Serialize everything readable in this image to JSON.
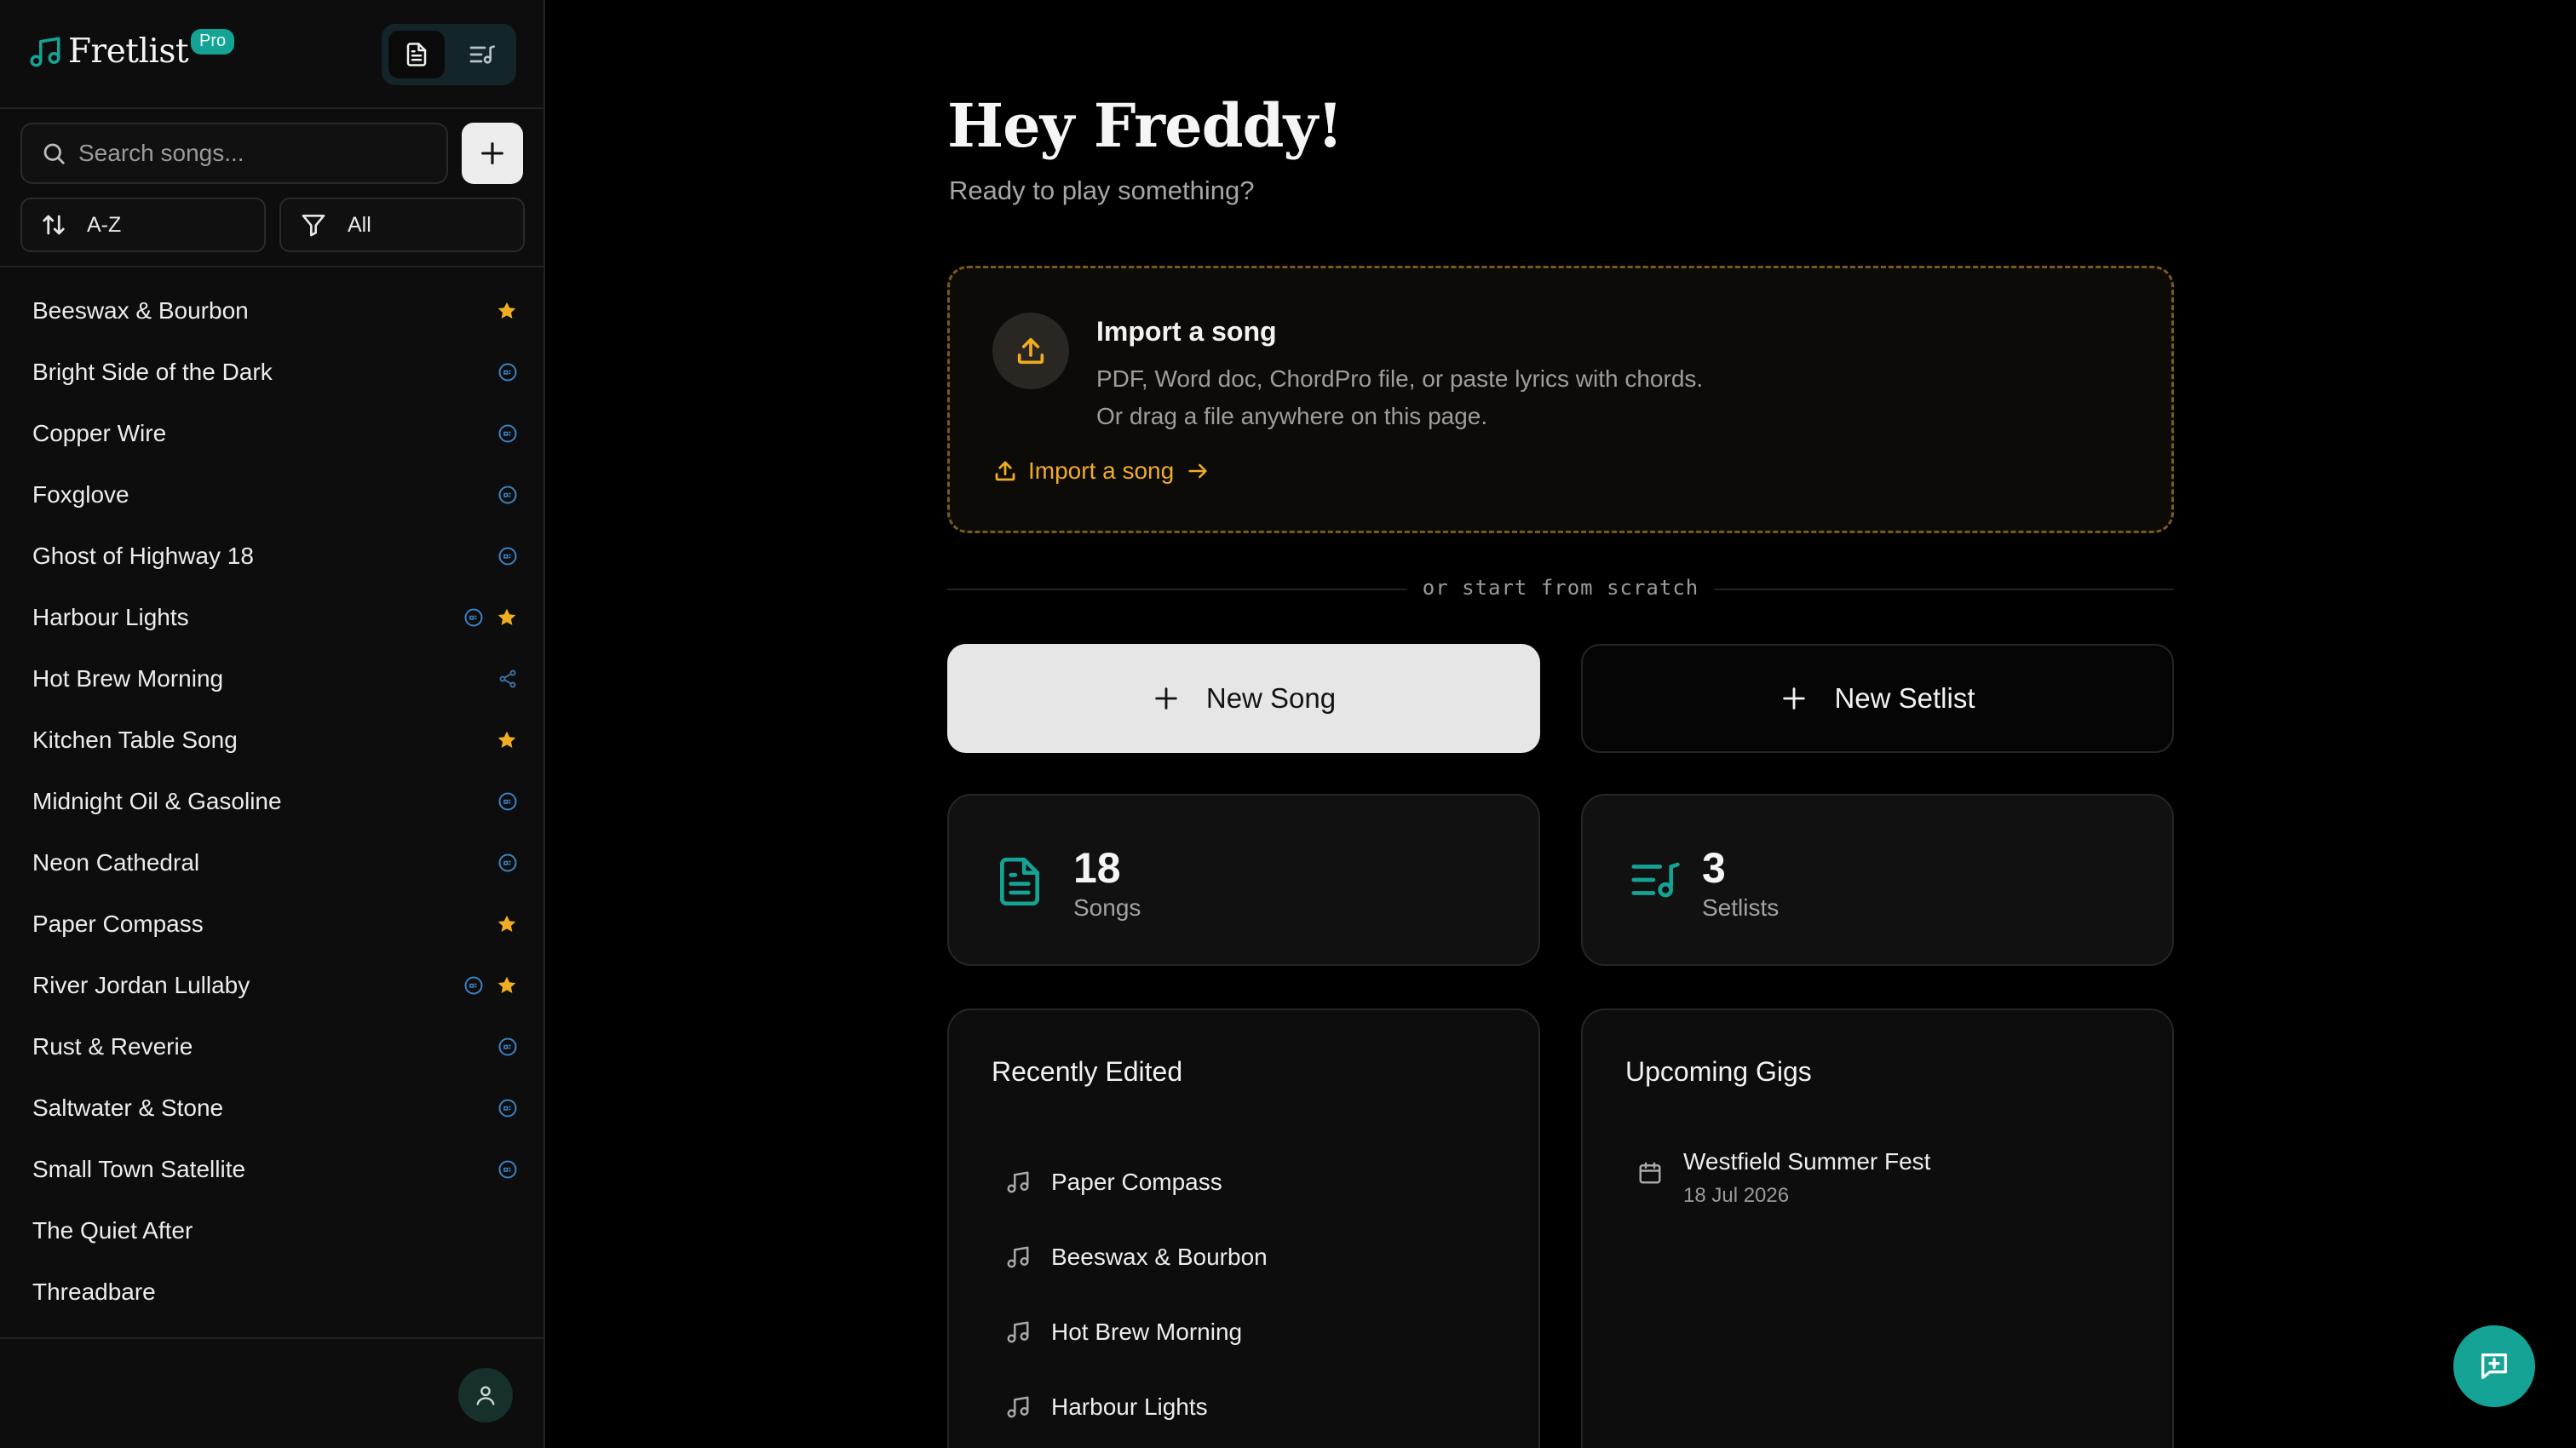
{
  "app": {
    "name": "Fretlist",
    "plan_badge": "Pro"
  },
  "sidebar": {
    "search_placeholder": "Search songs...",
    "sort_label": "A-Z",
    "filter_label": "All",
    "songs": [
      {
        "title": "Beeswax & Bourbon",
        "icons": [
          "star-icon"
        ]
      },
      {
        "title": "Bright Side of the Dark",
        "icons": [
          "chord-badge-icon"
        ]
      },
      {
        "title": "Copper Wire",
        "icons": [
          "chord-badge-icon"
        ]
      },
      {
        "title": "Foxglove",
        "icons": [
          "chord-badge-icon"
        ]
      },
      {
        "title": "Ghost of Highway 18",
        "icons": [
          "chord-badge-icon"
        ]
      },
      {
        "title": "Harbour Lights",
        "icons": [
          "chord-badge-icon",
          "star-icon"
        ]
      },
      {
        "title": "Hot Brew Morning",
        "icons": [
          "share-icon"
        ]
      },
      {
        "title": "Kitchen Table Song",
        "icons": [
          "star-icon"
        ]
      },
      {
        "title": "Midnight Oil & Gasoline",
        "icons": [
          "chord-badge-icon"
        ]
      },
      {
        "title": "Neon Cathedral",
        "icons": [
          "chord-badge-icon"
        ]
      },
      {
        "title": "Paper Compass",
        "icons": [
          "star-icon"
        ]
      },
      {
        "title": "River Jordan Lullaby",
        "icons": [
          "chord-badge-icon",
          "star-icon"
        ]
      },
      {
        "title": "Rust & Reverie",
        "icons": [
          "chord-badge-icon"
        ]
      },
      {
        "title": "Saltwater & Stone",
        "icons": [
          "chord-badge-icon"
        ]
      },
      {
        "title": "Small Town Satellite",
        "icons": [
          "chord-badge-icon"
        ]
      },
      {
        "title": "The Quiet After",
        "icons": []
      },
      {
        "title": "Threadbare",
        "icons": []
      }
    ]
  },
  "main": {
    "greeting": "Hey Freddy!",
    "subgreeting": "Ready to play something?",
    "import": {
      "title": "Import a song",
      "desc_line1": "PDF, Word doc, ChordPro file, or paste lyrics with chords.",
      "desc_line2": "Or drag a file anywhere on this page.",
      "link_label": "Import a song"
    },
    "separator": "or start from scratch",
    "new_song_label": "New Song",
    "new_setlist_label": "New Setlist",
    "stats": {
      "songs_count": "18",
      "songs_label": "Songs",
      "setlists_count": "3",
      "setlists_label": "Setlists"
    },
    "recently_edited": {
      "title": "Recently Edited",
      "items": [
        "Paper Compass",
        "Beeswax & Bourbon",
        "Hot Brew Morning",
        "Harbour Lights"
      ]
    },
    "upcoming_gigs": {
      "title": "Upcoming Gigs",
      "items": [
        {
          "name": "Westfield Summer Fest",
          "date": "18 Jul 2026"
        }
      ]
    }
  },
  "colors": {
    "accent": "#14a394",
    "gold": "#f0ad22",
    "chord_blue": "#3b82c4",
    "background": "#000000"
  }
}
